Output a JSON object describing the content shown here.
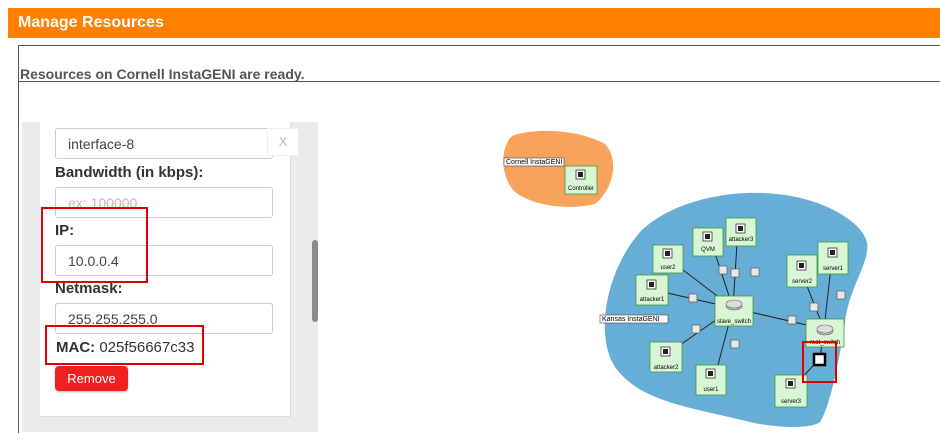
{
  "window": {
    "title": "Manage Resources"
  },
  "status": {
    "message": "Resources on Cornell InstaGENI are ready."
  },
  "form": {
    "interface_name_value": "interface-8",
    "clear_button_label": "X",
    "bandwidth_label": "Bandwidth (in kbps):",
    "bandwidth_placeholder": "ex: 100000",
    "ip_label": "IP:",
    "ip_value": "10.0.0.4",
    "netmask_label": "Netmask:",
    "netmask_value": "255.255.255.0",
    "mac_label": "MAC:",
    "mac_value": "025f56667c33",
    "remove_label": "Remove"
  },
  "topology": {
    "groups": [
      {
        "name": "Cornell InstaGENI",
        "color": "#f7a35c"
      },
      {
        "name": "Kansas InstaGENI",
        "color": "#67aed6"
      }
    ],
    "nodes": {
      "controller": "Controller",
      "attacker3": "attacker3",
      "qvm": "QVM",
      "user2": "user2",
      "attacker1": "attacker1",
      "attacker2": "attacker2",
      "user1": "user1",
      "server2": "server2",
      "server1": "server1",
      "server3": "server3",
      "slave_switch": "slave_switch",
      "root_switch": "root_switch"
    },
    "colors": {
      "node_fill": "#d9f6d4",
      "node_border": "#3c9a3c",
      "highlight": "#e00000",
      "accent": "#ff7f00"
    }
  }
}
